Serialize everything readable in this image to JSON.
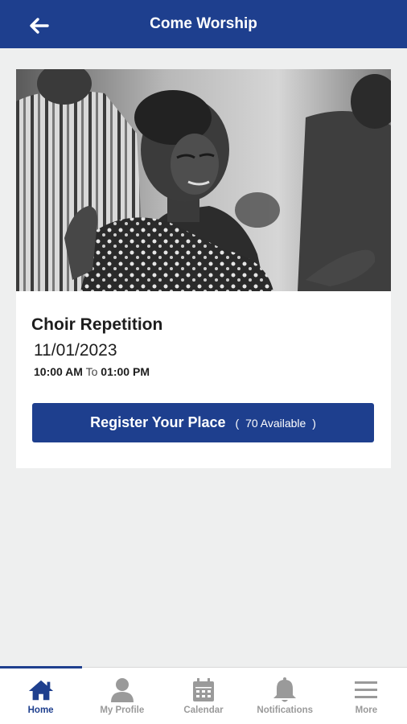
{
  "header": {
    "title": "Come Worship",
    "back_icon": "arrow-left-icon",
    "background": "#1e3f8e"
  },
  "event": {
    "image_description": "worship-photo",
    "title": "Choir Repetition",
    "date": "11/01/2023",
    "start_time": "10:00 AM",
    "to_label": "To",
    "end_time": "01:00 PM",
    "register_label": "Register Your Place",
    "available_open": "(",
    "available_text": "70 Available",
    "available_close": ")"
  },
  "bottom_nav": {
    "items": [
      {
        "label": "Home",
        "icon": "home-icon",
        "active": true
      },
      {
        "label": "My Profile",
        "icon": "profile-icon",
        "active": false
      },
      {
        "label": "Calendar",
        "icon": "calendar-icon",
        "active": false
      },
      {
        "label": "Notifications",
        "icon": "bell-icon",
        "active": false
      },
      {
        "label": "More",
        "icon": "menu-icon",
        "active": false
      }
    ]
  },
  "colors": {
    "brand": "#1e3f8e",
    "background": "#eeefef",
    "inactive": "#9a9a9a"
  }
}
